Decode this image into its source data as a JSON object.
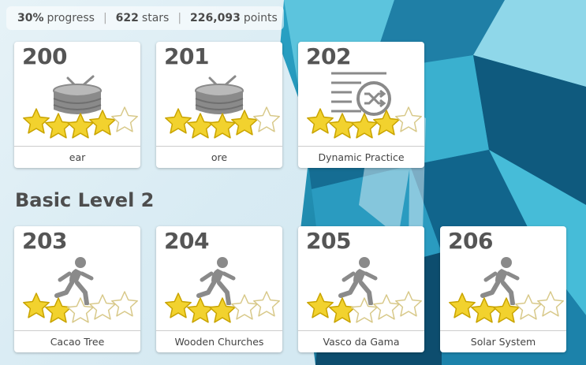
{
  "status": {
    "progress": "30%",
    "progress_label": "progress",
    "stars": "622",
    "stars_label": "stars",
    "points": "226,093",
    "points_label": "points"
  },
  "section_title": "Basic Level 2",
  "cards": [
    {
      "number": "200",
      "label": "ear",
      "icon": "drum-icon",
      "filled_stars": 4
    },
    {
      "number": "201",
      "label": "ore",
      "icon": "drum-icon",
      "filled_stars": 4
    },
    {
      "number": "202",
      "label": "Dynamic Practice",
      "icon": "shuffle-list-icon",
      "filled_stars": 4
    },
    {
      "number": "203",
      "label": "Cacao Tree",
      "icon": "runner-icon",
      "filled_stars": 2
    },
    {
      "number": "204",
      "label": "Wooden Churches",
      "icon": "runner-icon",
      "filled_stars": 3
    },
    {
      "number": "205",
      "label": "Vasco da Gama",
      "icon": "runner-icon",
      "filled_stars": 2
    },
    {
      "number": "206",
      "label": "Solar System",
      "icon": "runner-icon",
      "filled_stars": 3
    }
  ],
  "colors": {
    "star_fill": "#f2d22e",
    "star_outline": "#c9a400",
    "icon_gray": "#8a8a8a",
    "crystal_blue": "#1d8fb5"
  }
}
